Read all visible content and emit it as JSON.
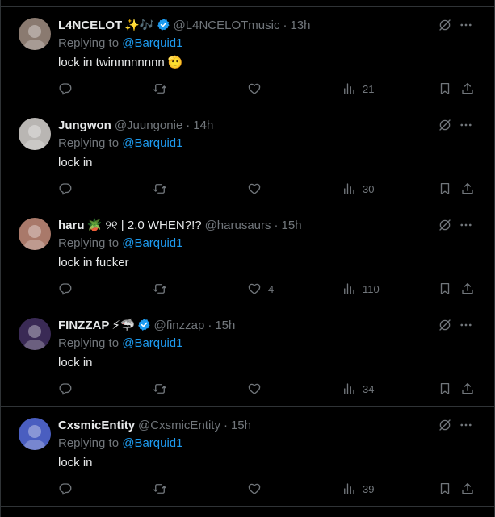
{
  "replies": [
    {
      "name": "L4NCELOT",
      "name_emoji": "✨🎶",
      "verified": true,
      "handle": "@L4NCELOTmusic",
      "time": "13h",
      "replying_label": "Replying to ",
      "replying_to": "@Barquid1",
      "text": "lock in twinnnnnnnn 🫡",
      "replies_count": "",
      "retweets_count": "",
      "likes_count": "",
      "views_count": "21",
      "avatar_color": "#8a7a70"
    },
    {
      "name": "Jungwon",
      "name_emoji": "",
      "verified": false,
      "handle": "@Juungonie",
      "time": "14h",
      "replying_label": "Replying to ",
      "replying_to": "@Barquid1",
      "text": "lock in",
      "replies_count": "",
      "retweets_count": "",
      "likes_count": "",
      "views_count": "30",
      "avatar_color": "#b9b6b3"
    },
    {
      "name": "haru",
      "name_emoji": "🪴 ୨୧ | 2.0 WHEN?!?",
      "verified": false,
      "handle": "@harusaurs",
      "time": "15h",
      "replying_label": "Replying to ",
      "replying_to": "@Barquid1",
      "text": "lock in fucker",
      "replies_count": "",
      "retweets_count": "",
      "likes_count": "4",
      "views_count": "110",
      "avatar_color": "#a9796a"
    },
    {
      "name": "FINZZAP",
      "name_emoji": "⚡🦈",
      "verified": true,
      "handle": "@finzzap",
      "time": "15h",
      "replying_label": "Replying to ",
      "replying_to": "@Barquid1",
      "text": "lock in",
      "replies_count": "",
      "retweets_count": "",
      "likes_count": "",
      "views_count": "34",
      "avatar_color": "#3a2a55"
    },
    {
      "name": "CxsmicEntity",
      "name_emoji": "",
      "verified": false,
      "handle": "@CxsmicEntity",
      "time": "15h",
      "replying_label": "Replying to ",
      "replying_to": "@Barquid1",
      "text": "lock in",
      "replies_count": "",
      "retweets_count": "",
      "likes_count": "",
      "views_count": "39",
      "avatar_color": "#4a5ec0"
    }
  ],
  "icons": {
    "reply": "reply-icon",
    "retweet": "retweet-icon",
    "like": "heart-icon",
    "views": "views-icon",
    "bookmark": "bookmark-icon",
    "share": "share-icon",
    "grok": "grok-icon",
    "more": "more-icon",
    "verified": "verified-badge-icon"
  },
  "colors": {
    "background": "#000000",
    "text": "#e7e9ea",
    "muted": "#71767b",
    "accent": "#1d9bf0",
    "divider": "#2f3336"
  }
}
